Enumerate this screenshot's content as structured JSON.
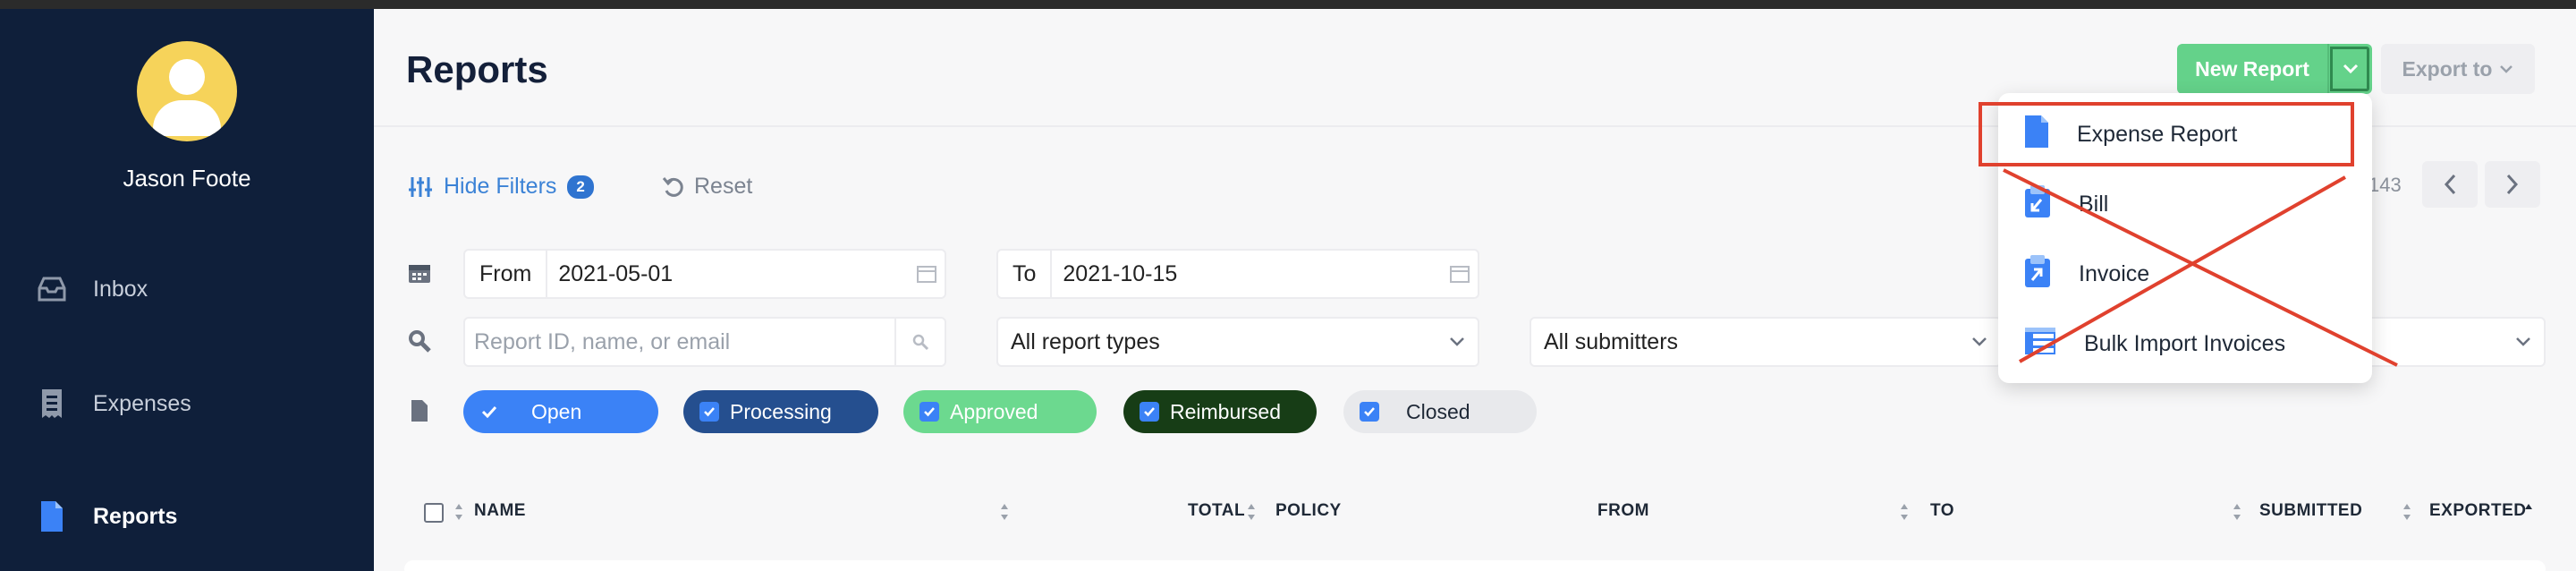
{
  "user": {
    "name": "Jason Foote"
  },
  "sidebar": {
    "items": [
      {
        "label": "Inbox",
        "icon": "inbox-icon",
        "active": false
      },
      {
        "label": "Expenses",
        "icon": "receipt-icon",
        "active": false
      },
      {
        "label": "Reports",
        "icon": "document-icon",
        "active": true
      }
    ]
  },
  "header": {
    "title": "Reports",
    "new_report_label": "New Report",
    "export_label": "Export to"
  },
  "filters": {
    "toggle_label": "Hide Filters",
    "count": "2",
    "reset_label": "Reset",
    "from_label": "From",
    "from_value": "2021-05-01",
    "to_label": "To",
    "to_value": "2021-10-15",
    "search_placeholder": "Report ID, name, or email",
    "report_types": "All report types",
    "submitters": "All submitters",
    "statuses": [
      {
        "label": "Open",
        "bg": "#3b82f6",
        "fg": "#ffffff"
      },
      {
        "label": "Processing",
        "bg": "#254f8f",
        "fg": "#ffffff"
      },
      {
        "label": "Approved",
        "bg": "#6cd98f",
        "fg": "#ffffff"
      },
      {
        "label": "Reimbursed",
        "bg": "#173d16",
        "fg": "#ffffff"
      },
      {
        "label": "Closed",
        "bg": "#e8e9ec",
        "fg": "#1f2937"
      }
    ]
  },
  "pager": {
    "text": "143"
  },
  "table": {
    "columns": [
      "NAME",
      "TOTAL",
      "POLICY",
      "FROM",
      "TO",
      "SUBMITTED",
      "EXPORTED"
    ]
  },
  "dropdown": {
    "items": [
      {
        "label": "Expense Report",
        "icon": "document-icon"
      },
      {
        "label": "Bill",
        "icon": "bill-icon"
      },
      {
        "label": "Invoice",
        "icon": "invoice-icon"
      },
      {
        "label": "Bulk Import Invoices",
        "icon": "table-icon"
      }
    ]
  },
  "colors": {
    "sidebar": "#0f1f3a",
    "accent": "#3b82d6",
    "new_report": "#64d28a",
    "annotation": "#e0412e"
  }
}
